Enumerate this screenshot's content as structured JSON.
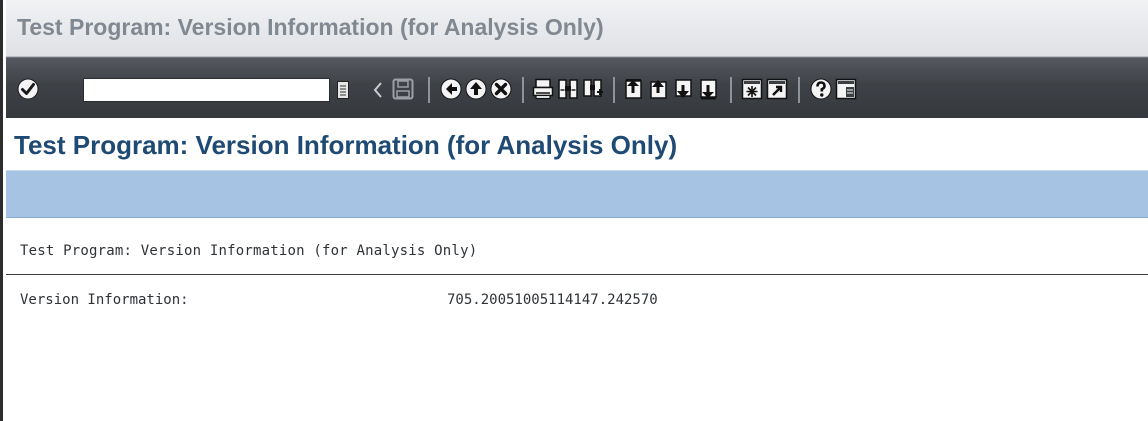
{
  "window": {
    "title": "Test Program: Version Information (for Analysis Only)"
  },
  "toolbar": {
    "command_field_value": "",
    "icons": [
      "enter-check-icon",
      "command-field-dropdown-icon",
      "collapse-arrow-icon",
      "save-icon",
      "back-icon",
      "exit-icon",
      "cancel-icon",
      "print-icon",
      "find-icon",
      "find-next-icon",
      "first-page-icon",
      "previous-page-icon",
      "next-page-icon",
      "last-page-icon",
      "create-session-icon",
      "shortcut-icon",
      "help-icon",
      "layout-menu-icon"
    ]
  },
  "app": {
    "title": "Test Program: Version Information (for Analysis Only)"
  },
  "list": {
    "heading": "Test Program: Version Information (for Analysis Only)",
    "rows": [
      {
        "label": "Version Information:",
        "value": "705.20051005114147.242570"
      }
    ]
  },
  "colors": {
    "title_text": "#808891",
    "app_title_text": "#1e4a74",
    "toolbar_bg": "#3e4247",
    "app_toolbar_bg": "#a6c3e3",
    "list_text": "#2e3338"
  }
}
